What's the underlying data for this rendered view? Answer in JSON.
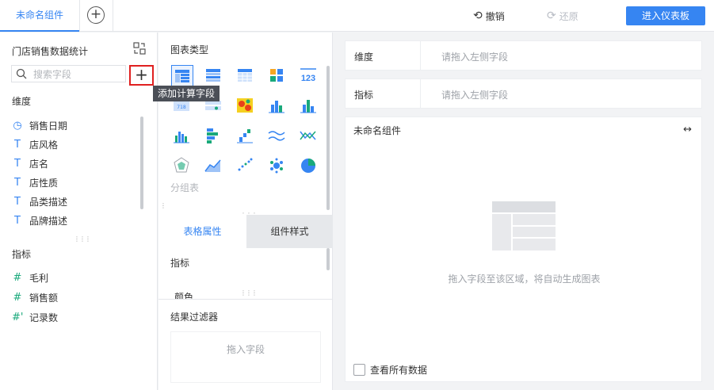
{
  "topbar": {
    "tab_label": "未命名组件",
    "add_tab": "+",
    "undo_label": "撤销",
    "redo_label": "还原",
    "enter_dashboard": "进入仪表板"
  },
  "left": {
    "dataset_title": "门店销售数据统计",
    "search_placeholder": "搜索字段",
    "add_calc": "+",
    "tooltip": "添加计算字段",
    "dimension_label": "维度",
    "dimensions": [
      {
        "icon": "clock-icon",
        "label": "销售日期"
      },
      {
        "icon": "text-field-icon",
        "label": "店风格"
      },
      {
        "icon": "text-field-icon",
        "label": "店名"
      },
      {
        "icon": "text-field-icon",
        "label": "店性质"
      },
      {
        "icon": "text-field-icon",
        "label": "品类描述"
      },
      {
        "icon": "text-field-icon",
        "label": "品牌描述"
      }
    ],
    "metric_label": "指标",
    "metrics": [
      {
        "icon": "number-field-icon",
        "label": "毛利"
      },
      {
        "icon": "number-field-icon",
        "label": "销售额"
      },
      {
        "icon": "record-count-icon",
        "label": "记录数"
      }
    ]
  },
  "mid": {
    "chart_type_title": "图表类型",
    "group_table_label": "分组表",
    "tab_table_props": "表格属性",
    "tab_component_style": "组件样式",
    "metric_label": "指标",
    "color_label": "颜色",
    "result_filter_label": "结果过滤器",
    "drop_field": "拖入字段"
  },
  "right": {
    "dimension_shelf_label": "维度",
    "dimension_shelf_placeholder": "请拖入左侧字段",
    "metric_shelf_label": "指标",
    "metric_shelf_placeholder": "请拖入左侧字段",
    "canvas_title": "未命名组件",
    "empty_hint": "拖入字段至该区域，将自动生成图表",
    "view_all_data": "查看所有数据"
  },
  "colors": {
    "accent": "#3685f2",
    "highlight_border": "#e02020",
    "tooltip_bg": "#4b4f57"
  }
}
